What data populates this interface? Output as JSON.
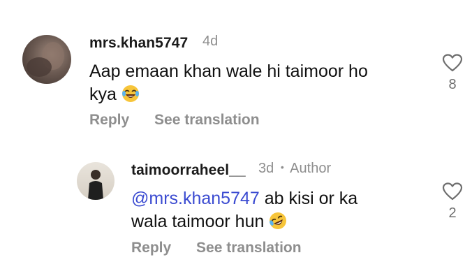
{
  "comments": [
    {
      "username": "mrs.khan5747",
      "time": "4d",
      "text": "Aap emaan khan wale hi taimoor ho kya",
      "text_line1": "Aap emaan khan wale hi taimoor ho",
      "text_line2": "kya",
      "emoji": "laughing-tears-emoji",
      "likes": "8",
      "reply_label": "Reply",
      "translate_label": "See translation"
    },
    {
      "username": "taimoorraheel__",
      "time": "3d",
      "separator": "•",
      "author_badge": "Author",
      "mention": "@mrs.khan5747",
      "text_line1_rest": " ab kisi or ka",
      "text_line2": "wala taimoor hun",
      "emoji": "rolling-laughing-emoji",
      "likes": "2",
      "reply_label": "Reply",
      "translate_label": "See translation"
    }
  ],
  "colors": {
    "muted": "#8e8e8e",
    "mention": "#3b4bd1",
    "text": "#111111"
  }
}
